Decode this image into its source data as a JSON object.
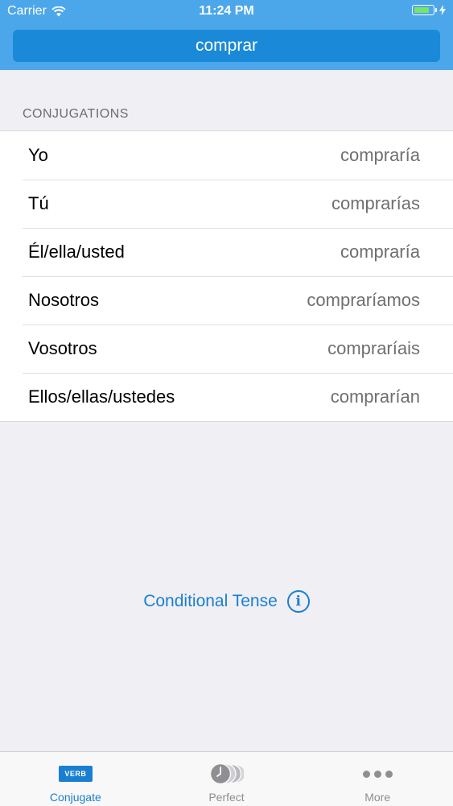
{
  "status_bar": {
    "carrier": "Carrier",
    "time": "11:24 PM"
  },
  "verb_input": {
    "value": "comprar"
  },
  "section": {
    "title": "CONJUGATIONS"
  },
  "conjugations": [
    {
      "pronoun": "Yo",
      "form": "compraría"
    },
    {
      "pronoun": "Tú",
      "form": "comprarías"
    },
    {
      "pronoun": "Él/ella/usted",
      "form": "compraría"
    },
    {
      "pronoun": "Nosotros",
      "form": "compraríamos"
    },
    {
      "pronoun": "Vosotros",
      "form": "compraríais"
    },
    {
      "pronoun": "Ellos/ellas/ustedes",
      "form": "comprarían"
    }
  ],
  "tense": {
    "label": "Conditional Tense",
    "info_icon_glyph": "i"
  },
  "tabbar": {
    "tabs": [
      {
        "label": "Conjugate",
        "icon": "verb-icon",
        "icon_text": "VERB",
        "active": true
      },
      {
        "label": "Perfect",
        "icon": "clock-stack-icon",
        "active": false
      },
      {
        "label": "More",
        "icon": "more-dots-icon",
        "active": false
      }
    ]
  },
  "colors": {
    "header": "#4ca7ea",
    "verb_field": "#1a8ad8",
    "accent": "#1a7fd1",
    "background": "#efeff4",
    "battery": "#7be36a"
  }
}
